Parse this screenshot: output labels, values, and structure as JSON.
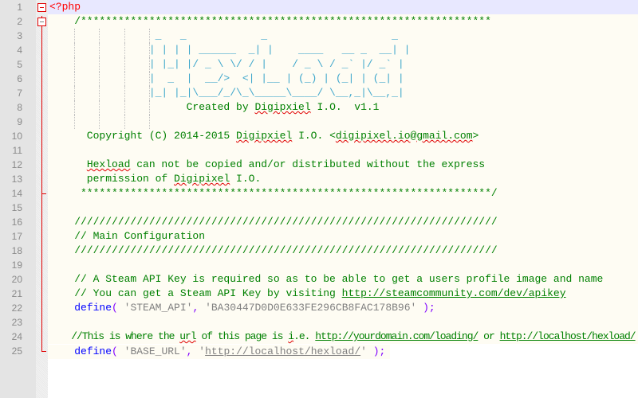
{
  "editor": {
    "current_line": 1,
    "colors": {
      "comment": "#008000",
      "keyword": "#0000ff",
      "string": "#808080",
      "php_tag": "#ff0000",
      "operator": "#8000ff",
      "ascii_art": "#3fa7cc",
      "current_line_bg": "#e8e8ff",
      "code_bg": "#fefcf3"
    },
    "lines": [
      [
        {
          "t": "<?php",
          "c": "php"
        }
      ],
      [
        {
          "t": "    /******************************************************************",
          "c": "cm"
        }
      ],
      [
        {
          "t": "                 _   _            _                    _",
          "c": "art"
        }
      ],
      [
        {
          "t": "                | | | | ______  _| |    ____   __ _  __| |",
          "c": "art"
        }
      ],
      [
        {
          "t": "                | |_| |/ _ \\ \\/ / |    / _ \\ / _` |/ _` |",
          "c": "art"
        }
      ],
      [
        {
          "t": "                |  _  |  __/>  <| |__ | (_) | (_| | (_| |",
          "c": "art"
        }
      ],
      [
        {
          "t": "                |_| |_|\\___/_/\\_\\_____\\____/ \\__,_|\\__,_|",
          "c": "art"
        }
      ],
      [
        {
          "t": "                      Created by ",
          "c": "cm"
        },
        {
          "t": "Digipxiel",
          "c": "cm sq"
        },
        {
          "t": " I.O.  v1.1",
          "c": "cm"
        }
      ],
      [
        {
          "t": "",
          "c": "cm"
        }
      ],
      [
        {
          "t": "      Copyright (C) 2014-2015 ",
          "c": "cm"
        },
        {
          "t": "Digipxiel",
          "c": "cm sq"
        },
        {
          "t": " I.O. <",
          "c": "cm"
        },
        {
          "t": "digipixel.io",
          "c": "cm sq"
        },
        {
          "t": "@",
          "c": "cm"
        },
        {
          "t": "gmail.com",
          "c": "cm sq"
        },
        {
          "t": ">",
          "c": "cm"
        }
      ],
      [
        {
          "t": "",
          "c": "cm"
        }
      ],
      [
        {
          "t": "      ",
          "c": "cm"
        },
        {
          "t": "Hexload",
          "c": "cm sq"
        },
        {
          "t": " can not be copied and/or distributed without the express",
          "c": "cm"
        }
      ],
      [
        {
          "t": "      permission of ",
          "c": "cm"
        },
        {
          "t": "Digipixel",
          "c": "cm sq"
        },
        {
          "t": " I.O.",
          "c": "cm"
        }
      ],
      [
        {
          "t": "     ******************************************************************/",
          "c": "cm"
        }
      ],
      [
        {
          "t": "",
          "c": "cm"
        }
      ],
      [
        {
          "t": "    ////////////////////////////////////////////////////////////////////",
          "c": "cm"
        }
      ],
      [
        {
          "t": "    // Main Configuration",
          "c": "cm"
        }
      ],
      [
        {
          "t": "    ////////////////////////////////////////////////////////////////////",
          "c": "cm"
        }
      ],
      [
        {
          "t": "",
          "c": "cm"
        }
      ],
      [
        {
          "t": "    // A Steam API Key is required so as to be able to get a users profile image and name",
          "c": "cm"
        }
      ],
      [
        {
          "t": "    // You can get a Steam API Key by visiting ",
          "c": "cm"
        },
        {
          "t": "http://steamcommunity.com/dev/apikey",
          "c": "url"
        }
      ],
      [
        {
          "t": "    ",
          "c": ""
        },
        {
          "t": "define",
          "c": "kw"
        },
        {
          "t": "(",
          "c": "op"
        },
        {
          "t": " 'STEAM_API'",
          "c": "str"
        },
        {
          "t": ",",
          "c": "op"
        },
        {
          "t": " 'BA30447D0D0E633FE296CB8FAC178B96'",
          "c": "str"
        },
        {
          "t": " );",
          "c": "op"
        }
      ],
      [
        {
          "t": "",
          "c": ""
        }
      ],
      [
        {
          "t": "    //This is where the ",
          "c": "cm"
        },
        {
          "t": "url",
          "c": "cm sq"
        },
        {
          "t": " of this page is ",
          "c": "cm"
        },
        {
          "t": "i",
          "c": "cm sq"
        },
        {
          "t": ".e. ",
          "c": "cm"
        },
        {
          "t": "http://yourdomain.com/loading/",
          "c": "url"
        },
        {
          "t": " or ",
          "c": "cm"
        },
        {
          "t": "http://localhost/hexload/",
          "c": "url"
        }
      ],
      [
        {
          "t": "    ",
          "c": ""
        },
        {
          "t": "define",
          "c": "kw"
        },
        {
          "t": "(",
          "c": "op"
        },
        {
          "t": " 'BASE_URL'",
          "c": "str"
        },
        {
          "t": ",",
          "c": "op"
        },
        {
          "t": " '",
          "c": "str"
        },
        {
          "t": "http://localhost/hexload/",
          "c": "strurl"
        },
        {
          "t": "'",
          "c": "str"
        },
        {
          "t": " );",
          "c": "op"
        }
      ]
    ]
  }
}
